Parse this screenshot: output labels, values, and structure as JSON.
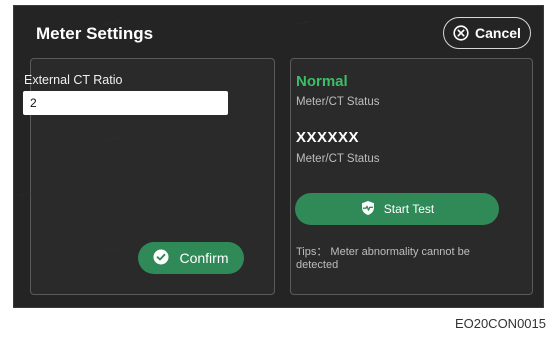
{
  "dialog": {
    "title": "Meter Settings",
    "cancel_label": "Cancel"
  },
  "ct_ratio": {
    "label": "External CT Ratio",
    "value": "2"
  },
  "confirm_label": "Confirm",
  "status": {
    "normal_text": "Normal",
    "normal_caption": "Meter/CT Status",
    "unknown_text": "XXXXXX",
    "unknown_caption": "Meter/CT Status"
  },
  "start_test_label": "Start Test",
  "tips": "Tips： Meter abnormality cannot be detected",
  "caption": "EO20CON0015",
  "colors": {
    "background": "#242424",
    "accent_green": "#2f8a57",
    "status_green": "#3bbf66"
  },
  "icons": {
    "cancel": "close-circle-icon",
    "confirm": "check-circle-icon",
    "start_test": "shield-heartbeat-icon"
  }
}
